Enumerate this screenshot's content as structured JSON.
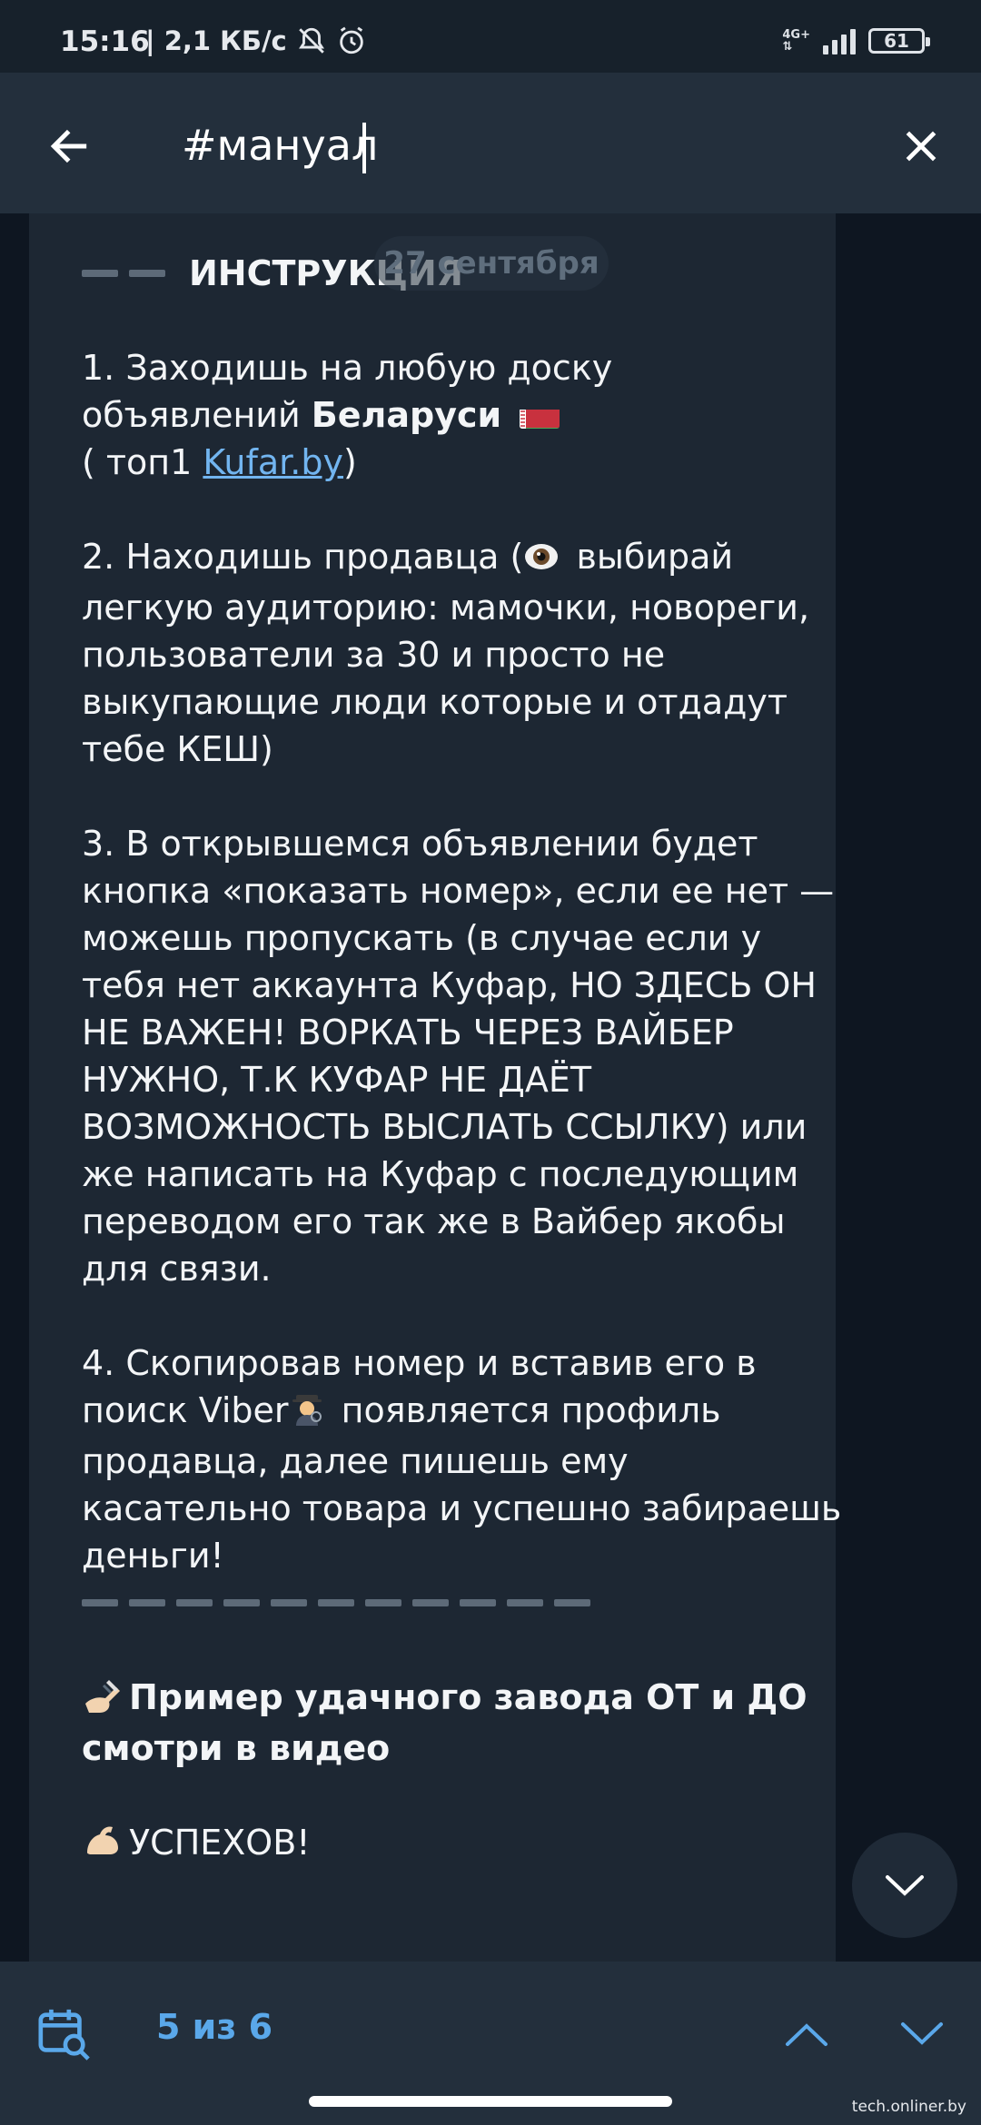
{
  "status_bar": {
    "time": "15:16",
    "speed": "| 2,1 КБ/с",
    "network_type": "4G+",
    "battery": "61"
  },
  "search": {
    "query": "#мануал"
  },
  "chat": {
    "date": "27 сентября",
    "heading": "ИНСТРУКЦИЯ",
    "p1_line1": "1. Заходишь на любую доску",
    "p1_line2_a": "объявлений ",
    "p1_line2_bold": "Беларуси",
    "p1_line3_a": "( топ1 ",
    "p1_link": "Kufar.by",
    "p1_line3_b": ")",
    "p2_a": "2. Находишь продавца (",
    "p2_b": " выбирай легкую аудиторию: мамочки, новореги, пользователи за 30 и просто не выкупающие люди которые и отдадут тебе КЕШ)",
    "p3": "3. В открывшемся объявлении будет кнопка «показать номер», если ее нет — можешь пропускать (в случае если у тебя нет аккаунта Куфар, НО ЗДЕСЬ ОН НЕ ВАЖЕН! ВОРКАТЬ ЧЕРЕЗ ВАЙБЕР НУЖНО, Т.К КУФАР НЕ ДАЁТ ВОЗМОЖНОСТЬ ВЫСЛАТЬ ССЫЛКУ) или же написать на Куфар с последующим переводом его так же в Вайбер якобы для связи.",
    "p4_a": "4. Скопировав номер и вставив его в поиск Viber",
    "p4_b": " появляется профиль продавца, далее пишешь ему касательно товара и успешно забираешь деньги!",
    "example_text": "Пример удачного завода ОТ и ДО смотри в видео",
    "success_text": "УСПЕХОВ!"
  },
  "bottom_bar": {
    "counter": "5 из 6"
  },
  "watermark": "tech.onliner.by",
  "icons": {
    "back": "arrow-left-icon",
    "close": "close-icon",
    "calendar": "calendar-search-icon",
    "up": "chevron-up-icon",
    "down": "chevron-down-icon"
  },
  "colors": {
    "background": "#0e1621",
    "header": "#232f3c",
    "bubble": "#1d2733",
    "accent": "#5aa8ea",
    "link": "#72b5f0"
  }
}
